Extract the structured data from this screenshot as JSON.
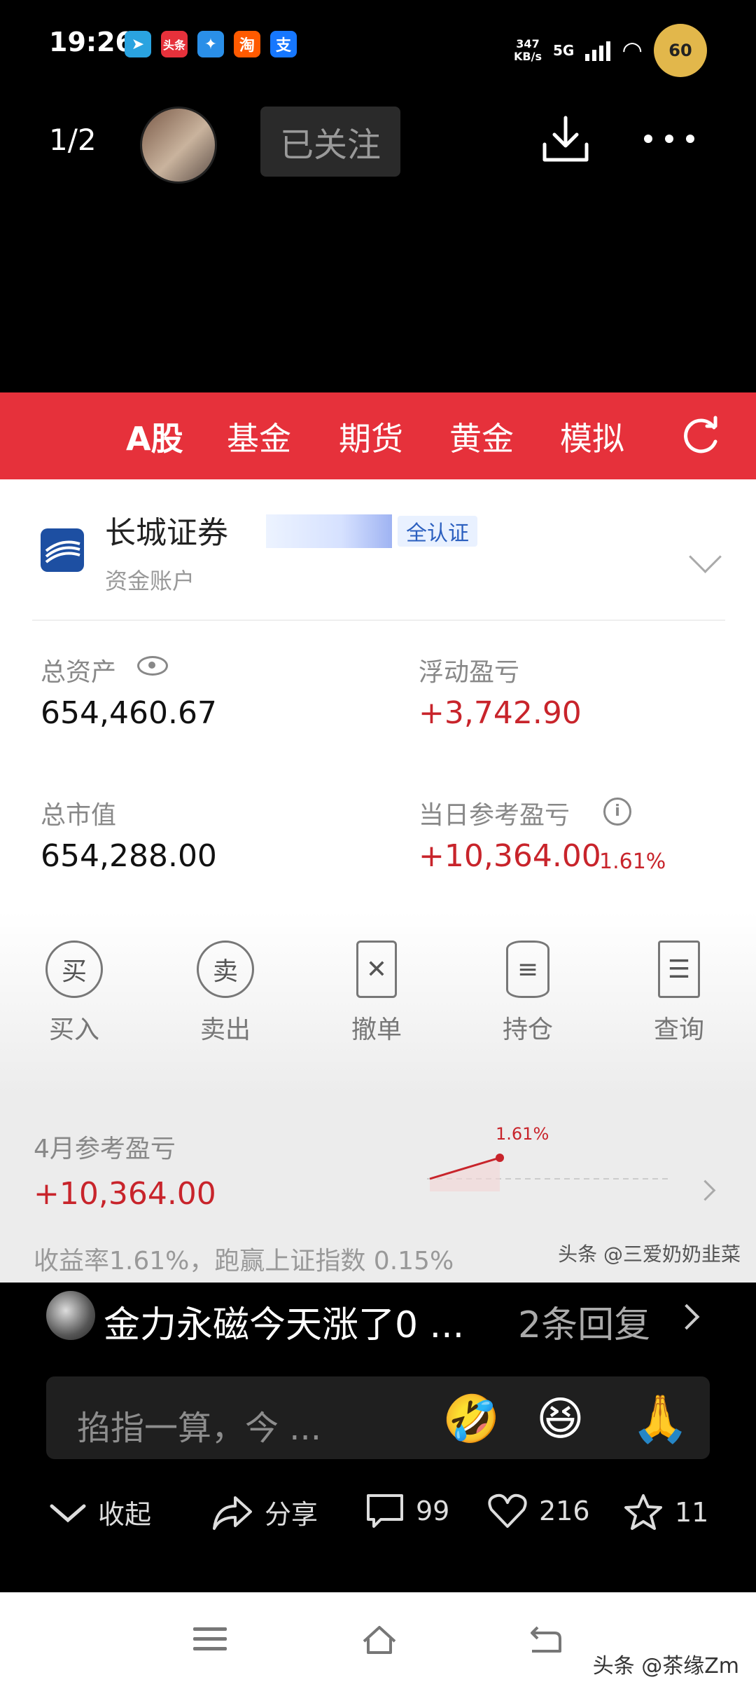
{
  "status_bar": {
    "time": "19:26",
    "app_icons": [
      {
        "name": "telegram-icon",
        "label": "",
        "color": "#2aa3e0"
      },
      {
        "name": "toutiao-icon",
        "label": "头条",
        "color": "#e6313b"
      },
      {
        "name": "feiyu-icon",
        "label": "",
        "color": "#2a8fe8"
      },
      {
        "name": "taobao-icon",
        "label": "淘",
        "color": "#ff5a00"
      },
      {
        "name": "alipay-icon",
        "label": "支",
        "color": "#1677ff"
      }
    ],
    "net_speed": "347",
    "net_unit": "KB/s",
    "network": "5G",
    "battery": "60"
  },
  "header": {
    "page_indicator": "1/2",
    "follow_label": "已关注"
  },
  "screenshot": {
    "tabs": [
      "A股",
      "基金",
      "期货",
      "黄金",
      "模拟"
    ],
    "account": {
      "name": "长城证券",
      "verify_label": "全认证",
      "sub": "资金账户"
    },
    "metrics": {
      "total_assets_label": "总资产",
      "total_assets": "654,460.67",
      "float_pnl_label": "浮动盈亏",
      "float_pnl": "+3,742.90",
      "market_value_label": "总市值",
      "market_value": "654,288.00",
      "daily_pnl_label": "当日参考盈亏",
      "daily_pnl": "+10,364.00",
      "daily_pct": "1.61%"
    },
    "actions": [
      {
        "label": "买入",
        "glyph": "买"
      },
      {
        "label": "卖出",
        "glyph": "卖"
      },
      {
        "label": "撤单",
        "glyph": "✕"
      },
      {
        "label": "持仓",
        "glyph": "≡"
      },
      {
        "label": "查询",
        "glyph": "☰"
      }
    ],
    "monthly": {
      "label": "4月参考盈亏",
      "value": "+10,364.00",
      "summary": "收益率1.61%，跑赢上证指数 0.15%",
      "chart_pct": "1.61%",
      "watermark": "头条 @三爱奶奶韭菜"
    }
  },
  "comment": {
    "text": "金力永磁今天涨了0 ...",
    "replies": "2条回复"
  },
  "input": {
    "placeholder": "掐指一算，今 ...",
    "emojis": [
      "🤣",
      "😆",
      "🙏"
    ]
  },
  "bottom_bar": {
    "collapse": "收起",
    "share": "分享",
    "comments": "99",
    "likes": "216",
    "favorites": "11"
  },
  "watermark": "头条 @茶缘Zm"
}
